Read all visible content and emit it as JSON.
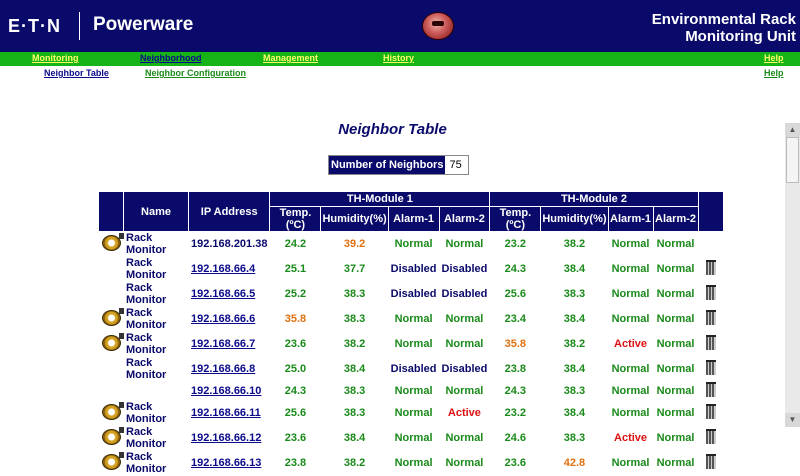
{
  "header": {
    "logo": "E·T·N",
    "brand": "Powerware",
    "product_line1": "Environmental Rack",
    "product_line2": "Monitoring Unit"
  },
  "nav": {
    "items": [
      {
        "label": "Monitoring"
      },
      {
        "label": "Neighborhood"
      },
      {
        "label": "Management"
      },
      {
        "label": "History"
      },
      {
        "label": "Help"
      }
    ],
    "sub_items": [
      {
        "label": "Neighbor Table"
      },
      {
        "label": "Neighbor Configuration"
      },
      {
        "label": "Help"
      }
    ]
  },
  "page": {
    "title": "Neighbor Table",
    "neighbors_label": "Number of Neighbors",
    "neighbors_count": "75"
  },
  "table": {
    "col_name": "Name",
    "col_ip": "IP Address",
    "group1": "TH-Module 1",
    "group2": "TH-Module 2",
    "col_temp": "Temp.(ºC)",
    "col_hum": "Humidity(%)",
    "col_alarm1": "Alarm-1",
    "col_alarm2": "Alarm-2",
    "rows": [
      {
        "icon": true,
        "name": "Rack Monitor",
        "ip": "192.168.201.38",
        "link": false,
        "t1": "24.2",
        "h1": "39.2",
        "a1": "Normal",
        "b1": "Normal",
        "t2": "23.2",
        "h2": "38.2",
        "a2": "Normal",
        "b2": "Normal",
        "trash": false
      },
      {
        "icon": false,
        "name": "Rack Monitor",
        "ip": "192.168.66.4",
        "link": true,
        "t1": "25.1",
        "h1": "37.7",
        "a1": "Disabled",
        "b1": "Disabled",
        "t2": "24.3",
        "h2": "38.4",
        "a2": "Normal",
        "b2": "Normal",
        "trash": true
      },
      {
        "icon": false,
        "name": "Rack Monitor",
        "ip": "192.168.66.5",
        "link": true,
        "t1": "25.2",
        "h1": "38.3",
        "a1": "Disabled",
        "b1": "Disabled",
        "t2": "25.6",
        "h2": "38.3",
        "a2": "Normal",
        "b2": "Normal",
        "trash": true
      },
      {
        "icon": true,
        "name": "Rack Monitor",
        "ip": "192.168.66.6",
        "link": true,
        "t1": "35.8",
        "h1": "38.3",
        "a1": "Normal",
        "b1": "Normal",
        "t2": "23.4",
        "h2": "38.4",
        "a2": "Normal",
        "b2": "Normal",
        "trash": true
      },
      {
        "icon": true,
        "name": "Rack Monitor",
        "ip": "192.168.66.7",
        "link": true,
        "t1": "23.6",
        "h1": "38.2",
        "a1": "Normal",
        "b1": "Normal",
        "t2": "35.8",
        "h2": "38.2",
        "a2": "Active",
        "b2": "Normal",
        "trash": true
      },
      {
        "icon": false,
        "name": "Rack Monitor",
        "ip": "192.168.66.8",
        "link": true,
        "t1": "25.0",
        "h1": "38.4",
        "a1": "Disabled",
        "b1": "Disabled",
        "t2": "23.8",
        "h2": "38.4",
        "a2": "Normal",
        "b2": "Normal",
        "trash": true
      },
      {
        "icon": false,
        "name": "",
        "ip": "192.168.66.10",
        "link": true,
        "t1": "24.3",
        "h1": "38.3",
        "a1": "Normal",
        "b1": "Normal",
        "t2": "24.3",
        "h2": "38.3",
        "a2": "Normal",
        "b2": "Normal",
        "trash": true
      },
      {
        "icon": true,
        "name": "Rack Monitor",
        "ip": "192.168.66.11",
        "link": true,
        "t1": "25.6",
        "h1": "38.3",
        "a1": "Normal",
        "b1": "Active",
        "t2": "23.2",
        "h2": "38.4",
        "a2": "Normal",
        "b2": "Normal",
        "trash": true
      },
      {
        "icon": true,
        "name": "Rack Monitor",
        "ip": "192.168.66.12",
        "link": true,
        "t1": "23.6",
        "h1": "38.4",
        "a1": "Normal",
        "b1": "Normal",
        "t2": "24.6",
        "h2": "38.3",
        "a2": "Active",
        "b2": "Normal",
        "trash": true
      },
      {
        "icon": true,
        "name": "Rack Monitor",
        "ip": "192.168.66.13",
        "link": true,
        "t1": "23.8",
        "h1": "38.2",
        "a1": "Normal",
        "b1": "Normal",
        "t2": "23.6",
        "h2": "42.8",
        "a2": "Normal",
        "b2": "Normal",
        "trash": true
      }
    ]
  },
  "colors": {
    "header_bg": "#0a0a6b",
    "nav_bg": "#17b417",
    "normal": "#1a8a1a",
    "warning": "#e07010",
    "active": "#dd1111",
    "disabled": "#0a0a6b"
  }
}
